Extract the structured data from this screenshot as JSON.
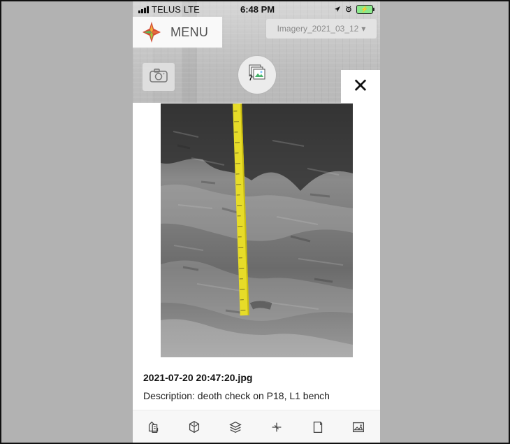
{
  "status_bar": {
    "carrier": "TELUS",
    "network": "LTE",
    "time": "6:48 PM",
    "battery_icon": "battery-charging-icon",
    "alarm_icon": "alarm-icon",
    "location_icon": "location-arrow-icon",
    "signal_icon": "signal-icon"
  },
  "header": {
    "menu_label": "MENU",
    "logo_icon": "app-logo",
    "imagery_selector": "Imagery_2021_03_12"
  },
  "map_controls": {
    "camera_icon": "camera-icon",
    "layers_icon": "layers-photo-icon",
    "badge_count": "7",
    "close_icon": "close-icon",
    "close_label": "✕"
  },
  "photo": {
    "filename": "2021-07-20 20:47:20.jpg",
    "description": "Description: deoth check on P18, L1 bench"
  },
  "bottom_toolbar": {
    "items": [
      {
        "name": "survey-icon"
      },
      {
        "name": "cube-icon"
      },
      {
        "name": "layers-icon"
      },
      {
        "name": "crosshair-icon"
      },
      {
        "name": "note-icon"
      },
      {
        "name": "image-icon"
      }
    ]
  },
  "colors": {
    "frame_background": "#b2b2b2",
    "text_primary": "#111111",
    "tape_yellow": "#e7dc28"
  }
}
